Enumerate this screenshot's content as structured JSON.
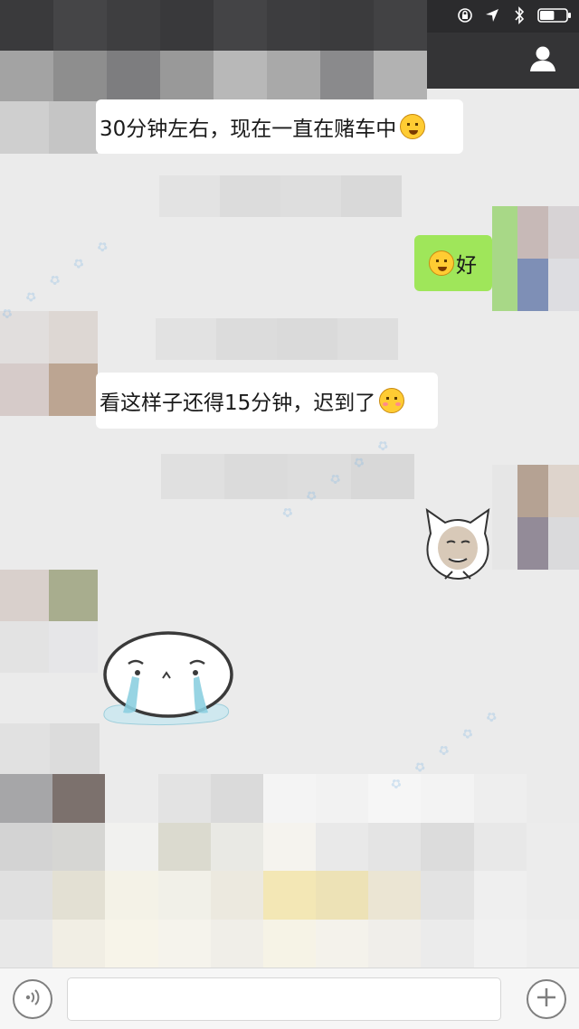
{
  "status_bar": {
    "icons": [
      "rotation-lock-icon",
      "location-arrow-icon",
      "bluetooth-icon",
      "battery-icon"
    ],
    "battery_level": 0.55
  },
  "nav_bar": {
    "profile_icon": "person-icon"
  },
  "messages": [
    {
      "direction": "received",
      "text": "30分钟左右，现在一直在赌车中",
      "emoji": "grinning-face-emoji"
    },
    {
      "direction": "sent",
      "text": "好",
      "emoji": "laughing-crying-face-emoji"
    },
    {
      "direction": "received",
      "text": "看这样子还得15分钟，迟到了",
      "emoji": "blushing-face-emoji"
    },
    {
      "direction": "sent",
      "sticker": "cat-face-meme-sticker"
    },
    {
      "direction": "received",
      "sticker": "crying-blob-sticker"
    }
  ],
  "input_bar": {
    "voice_icon": "voice-icon",
    "text_value": "",
    "plus_icon": "plus-icon"
  },
  "colors": {
    "sent_bubble": "#9fe65a",
    "received_bubble": "#ffffff",
    "chat_background": "#ebebeb",
    "nav_background": "#343436"
  }
}
